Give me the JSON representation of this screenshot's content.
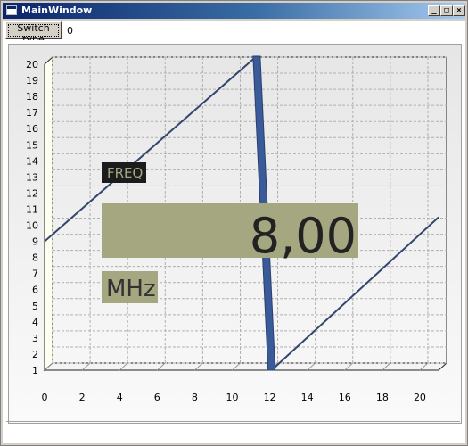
{
  "window": {
    "title": "MainWindow"
  },
  "toolbar": {
    "switch_label": "Switch type",
    "counter": "0"
  },
  "chart_data": {
    "type": "line",
    "x": [
      0,
      11.3,
      12.1,
      21
    ],
    "series": [
      {
        "values": [
          9,
          20.5,
          1,
          10.5
        ]
      }
    ],
    "xlim": [
      0,
      21
    ],
    "ylim": [
      1,
      20
    ],
    "xticks": [
      0,
      2,
      4,
      6,
      8,
      10,
      12,
      14,
      16,
      18,
      20
    ],
    "yticks": [
      1,
      2,
      3,
      4,
      5,
      6,
      7,
      8,
      9,
      10,
      11,
      12,
      13,
      14,
      15,
      16,
      17,
      18,
      19,
      20
    ],
    "grid": true,
    "line_color": "#34466e",
    "band_color": "#3a5a9a",
    "overlay_color": "#a5a781"
  },
  "overlay": {
    "label": "FREQ",
    "value": "8,00",
    "unit": "MHz"
  }
}
